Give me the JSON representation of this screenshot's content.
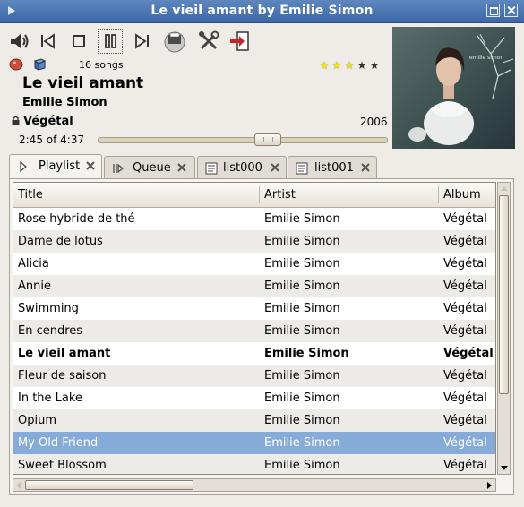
{
  "window": {
    "title": "Le vieil amant by Emilie Simon"
  },
  "toolbar": {
    "buttons": [
      "volume-icon",
      "previous-icon",
      "stop-icon",
      "pause-icon",
      "next-icon",
      "printer-icon",
      "preferences-icon",
      "quit-icon"
    ]
  },
  "info": {
    "song_count": "16 songs",
    "rating": 3,
    "rating_max": 5,
    "title": "Le vieil amant",
    "artist": "Emilie Simon",
    "album": "Végétal",
    "year": "2006",
    "time": "2:45 of 4:37",
    "progress": 0.595
  },
  "tabs": [
    {
      "label": "Playlist",
      "icon": "play-icon",
      "active": true
    },
    {
      "label": "Queue",
      "icon": "queue-icon",
      "active": false
    },
    {
      "label": "list000",
      "icon": "list-icon",
      "active": false
    },
    {
      "label": "list001",
      "icon": "list-icon",
      "active": false
    }
  ],
  "playlist": {
    "columns": [
      "Title",
      "Artist",
      "Album"
    ],
    "rows": [
      {
        "title": "Rose hybride de thé",
        "artist": "Emilie Simon",
        "album": "Végétal"
      },
      {
        "title": "Dame de lotus",
        "artist": "Emilie Simon",
        "album": "Végétal"
      },
      {
        "title": "Alicia",
        "artist": "Emilie Simon",
        "album": "Végétal"
      },
      {
        "title": "Annie",
        "artist": "Emilie Simon",
        "album": "Végétal"
      },
      {
        "title": "Swimming",
        "artist": "Emilie Simon",
        "album": "Végétal"
      },
      {
        "title": "En cendres",
        "artist": "Emilie Simon",
        "album": "Végétal"
      },
      {
        "title": "Le vieil amant",
        "artist": "Emilie Simon",
        "album": "Végétal",
        "playing": true
      },
      {
        "title": "Fleur de saison",
        "artist": "Emilie Simon",
        "album": "Végétal"
      },
      {
        "title": "In the Lake",
        "artist": "Emilie Simon",
        "album": "Végétal"
      },
      {
        "title": "Opium",
        "artist": "Emilie Simon",
        "album": "Végétal"
      },
      {
        "title": "My Old Friend",
        "artist": "Emilie Simon",
        "album": "Végétal",
        "selected": true
      },
      {
        "title": "Sweet Blossom",
        "artist": "Emilie Simon",
        "album": "Végétal"
      }
    ]
  },
  "colors": {
    "titlebar": "#4a74b0",
    "selection": "#86abd9",
    "star_on": "#f2e21a",
    "star_off": "#333333"
  }
}
